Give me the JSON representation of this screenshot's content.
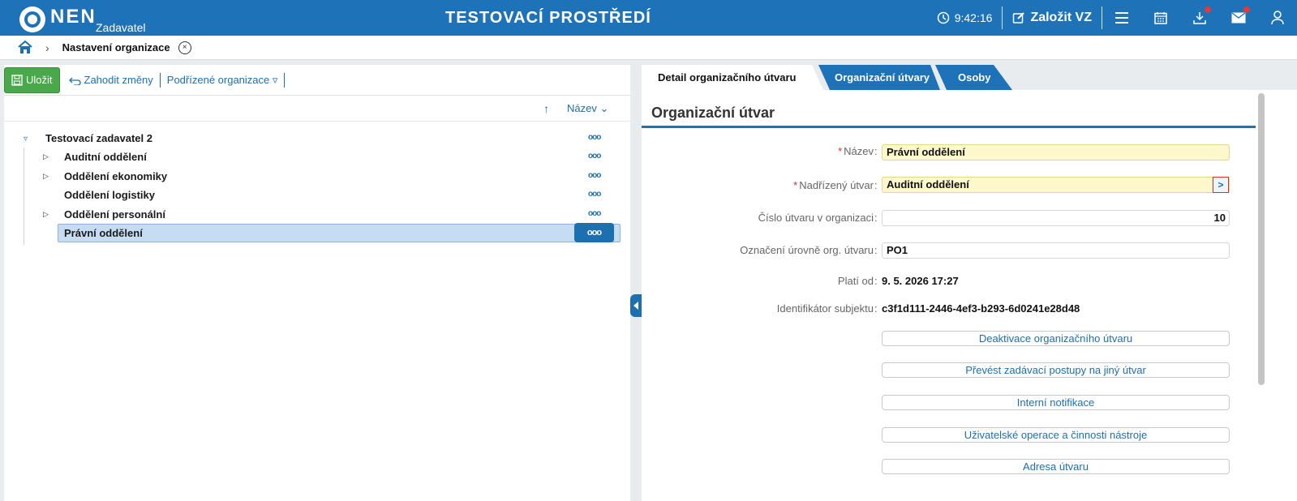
{
  "topbar": {
    "logo_text": "NEN",
    "logo_sub": "Zadavatel",
    "environment": "TESTOVACÍ PROSTŘEDÍ",
    "time": "9:42:16",
    "new_vz_label": "Založit VZ"
  },
  "breadcrumb": {
    "current": "Nastavení organizace",
    "close_symbol": "×"
  },
  "toolbar": {
    "save_label": "Uložit",
    "discard_label": "Zahodit změny",
    "sub_org_label": "Podřízené organizace ▿"
  },
  "sortbar": {
    "arrow": "↑",
    "label": "Název ⌄"
  },
  "tree": {
    "root": {
      "label": "Testovací zadavatel 2",
      "toggle": "▿"
    },
    "items": [
      {
        "label": "Auditní oddělení",
        "toggle": "▷"
      },
      {
        "label": "Oddělení ekonomiky",
        "toggle": "▷"
      },
      {
        "label": "Oddělení logistiky",
        "toggle": ""
      },
      {
        "label": "Oddělení personální",
        "toggle": "▷"
      },
      {
        "label": "Právní oddělení",
        "toggle": ""
      }
    ],
    "more_symbol": "ooo"
  },
  "tabs": {
    "detail": "Detail organizačního útvaru",
    "org_units": "Organizační útvary",
    "persons": "Osoby"
  },
  "detail": {
    "section_title": "Organizační útvar",
    "fields": {
      "name_label": "Název",
      "name_value": "Právní oddělení",
      "parent_label": "Nadřízený útvar",
      "parent_value": "Auditní oddělení",
      "number_label": "Číslo útvaru v organizaci",
      "number_value": "10",
      "level_label": "Označení úrovně org. útvaru",
      "level_value": "PO1",
      "valid_from_label": "Platí od",
      "valid_from_value": "9. 5. 2026 17:27",
      "subject_id_label": "Identifikátor subjektu",
      "subject_id_value": "c3f1d111-2446-4ef3-b293-6d0241e28d48"
    },
    "required_mark": "*",
    "colon": ":",
    "picker_symbol": ">",
    "actions": [
      "Deaktivace organizačního útvaru",
      "Převést zadávací postupy na jiný útvar",
      "Interní notifikace",
      "Uživatelské operace a činnosti nástroje",
      "Adresa útvaru"
    ]
  },
  "colors": {
    "brand": "#1d72b8",
    "save_green": "#49a94a",
    "required_bg": "#fdf8cc",
    "selected_row": "#c6dcf3"
  }
}
